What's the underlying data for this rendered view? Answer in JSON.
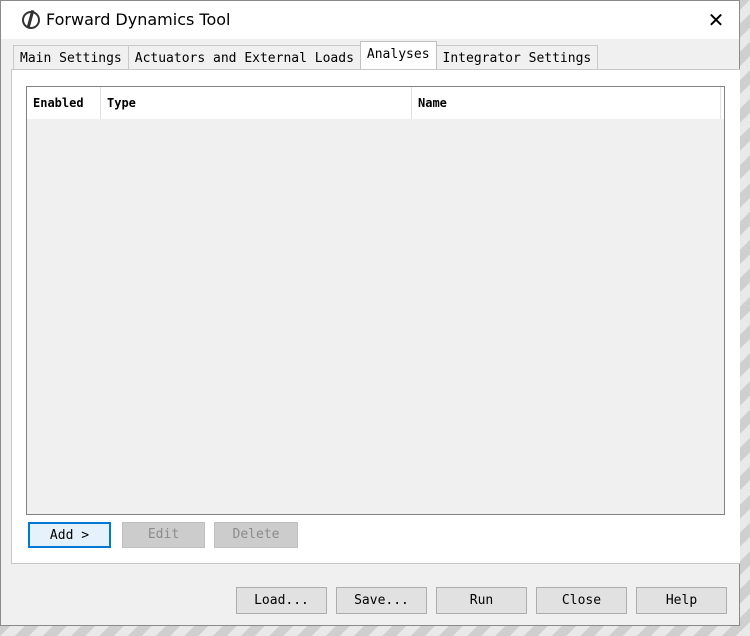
{
  "window": {
    "title": "Forward Dynamics Tool",
    "close_symbol": "✕"
  },
  "tabs": [
    {
      "label": "Main Settings",
      "active": false
    },
    {
      "label": "Actuators and External Loads",
      "active": false
    },
    {
      "label": "Analyses",
      "active": true
    },
    {
      "label": "Integrator Settings",
      "active": false
    }
  ],
  "analyses_table": {
    "columns": [
      "Enabled",
      "Type",
      "Name"
    ],
    "rows": []
  },
  "table_actions": {
    "add_label": "Add >",
    "edit_label": "Edit",
    "delete_label": "Delete"
  },
  "footer": {
    "load_label": "Load...",
    "save_label": "Save...",
    "run_label": "Run",
    "close_label": "Close",
    "help_label": "Help"
  },
  "icons": {
    "app": "opensim-logo-icon",
    "close": "close-icon"
  }
}
